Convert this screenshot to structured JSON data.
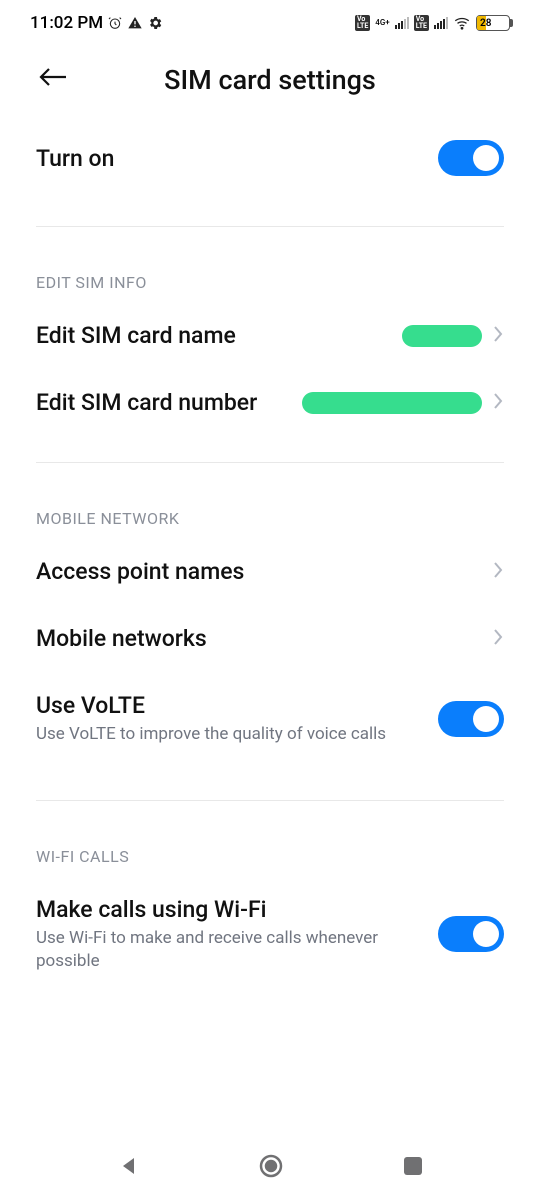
{
  "status": {
    "time": "11:02 PM",
    "battery_percent": "28",
    "network_badge_left": "4G+"
  },
  "header": {
    "title": "SIM card settings"
  },
  "turn_on": {
    "label": "Turn on"
  },
  "sections": {
    "edit_sim_info": {
      "header": "EDIT SIM INFO",
      "edit_name_label": "Edit SIM card name",
      "edit_number_label": "Edit SIM card number"
    },
    "mobile_network": {
      "header": "MOBILE NETWORK",
      "apn_label": "Access point names",
      "networks_label": "Mobile networks",
      "volte_label": "Use VoLTE",
      "volte_sub": "Use VoLTE to improve the quality of voice calls"
    },
    "wifi_calls": {
      "header": "WI-FI CALLS",
      "wifi_label": "Make calls using Wi-Fi",
      "wifi_sub": "Use Wi-Fi to make and receive calls whenever possible"
    }
  }
}
